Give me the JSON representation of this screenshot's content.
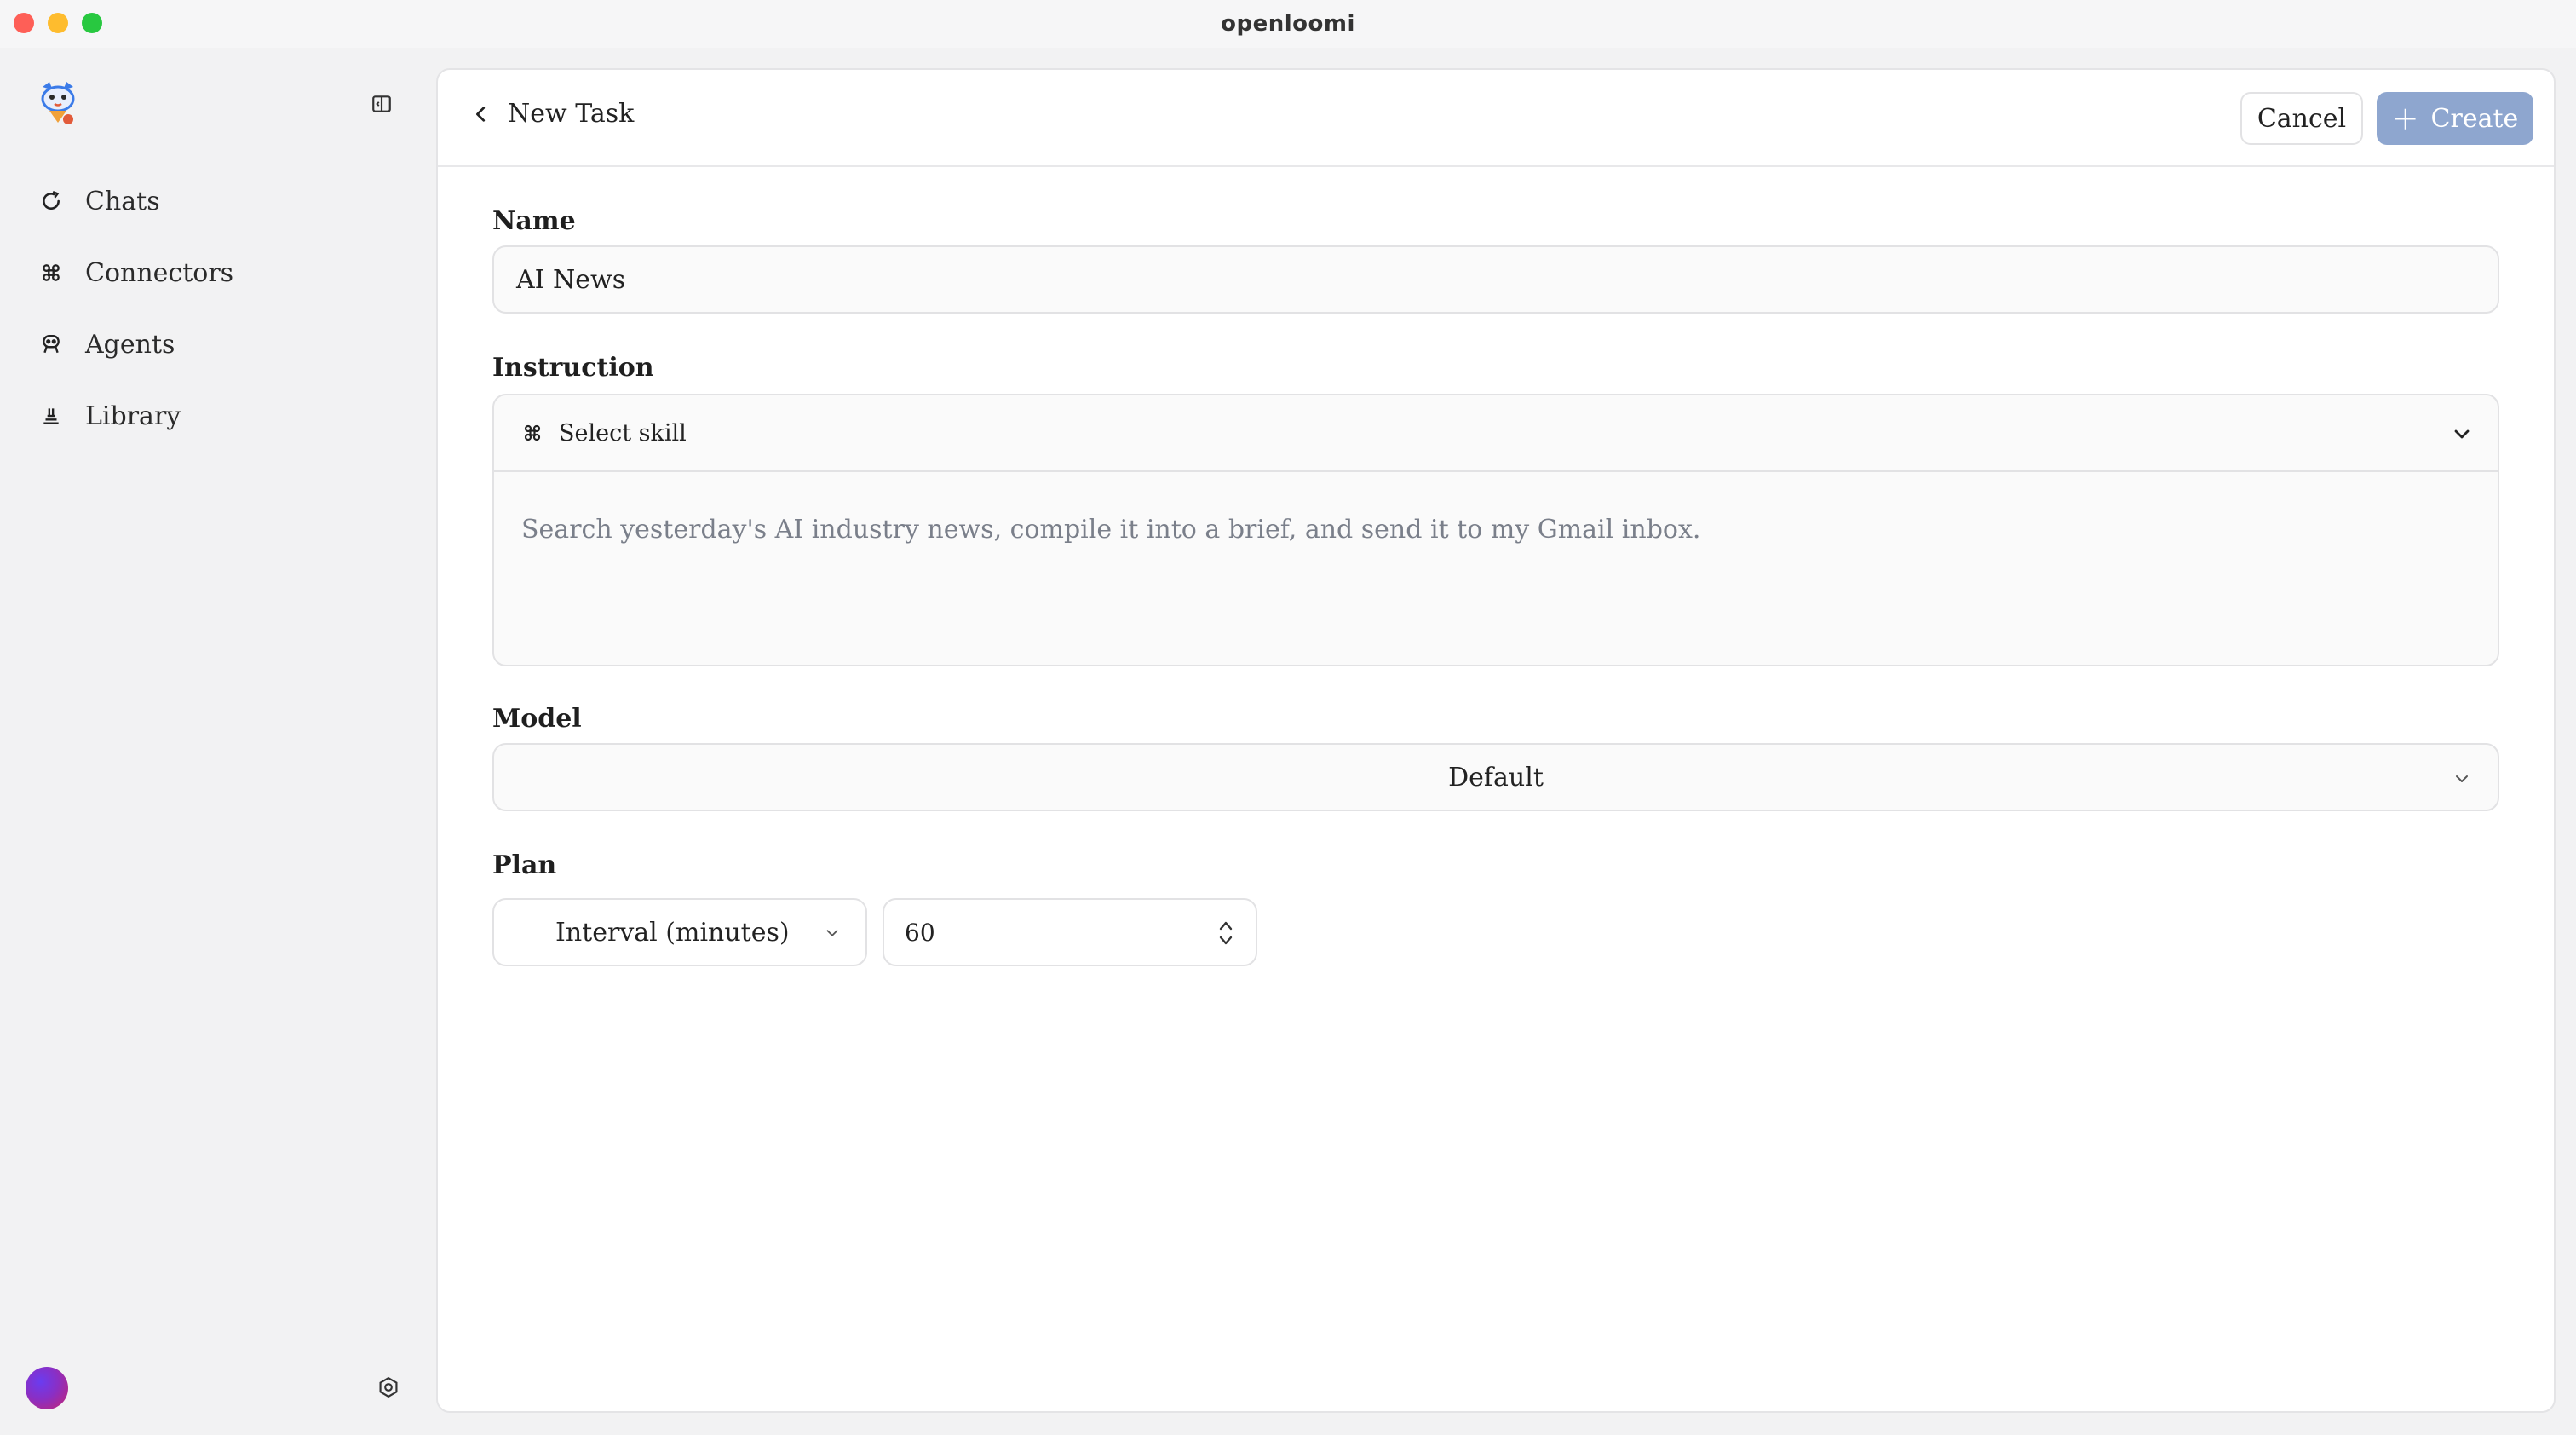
{
  "window": {
    "title": "openloomi"
  },
  "sidebar": {
    "items": [
      {
        "label": "Chats",
        "icon": "chat-refresh-icon"
      },
      {
        "label": "Connectors",
        "icon": "command-icon"
      },
      {
        "label": "Agents",
        "icon": "agent-icon"
      },
      {
        "label": "Library",
        "icon": "library-icon"
      }
    ]
  },
  "header": {
    "back_label": "New Task",
    "cancel_label": "Cancel",
    "create_label": "Create",
    "create_icon": "plus-icon"
  },
  "form": {
    "name": {
      "label": "Name",
      "value": "AI News"
    },
    "instruction": {
      "label": "Instruction",
      "skill_placeholder": "Select skill",
      "value": "Search yesterday's AI industry news, compile it into a brief, and send it to my Gmail inbox."
    },
    "model": {
      "label": "Model",
      "value": "Default"
    },
    "plan": {
      "label": "Plan",
      "type": "Interval (minutes)",
      "interval": "60"
    }
  },
  "colors": {
    "create_button": "#8ea6cf",
    "background": "#f2f2f3",
    "panel": "#ffffff"
  }
}
